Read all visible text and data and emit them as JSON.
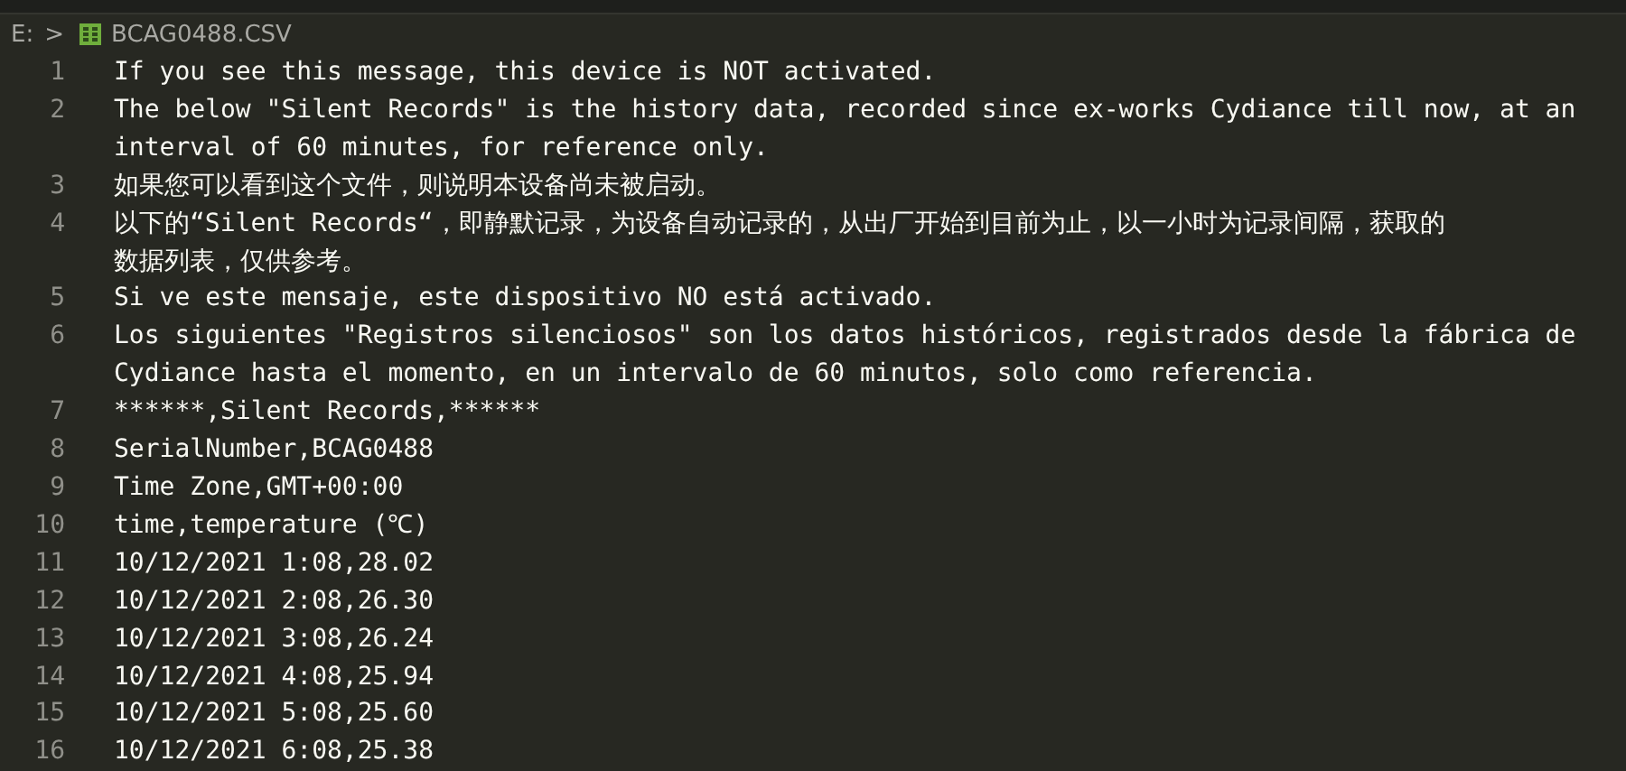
{
  "breadcrumb": {
    "drive": "E:",
    "separator": ">",
    "file": "BCAG0488.CSV"
  },
  "lines": [
    {
      "number": "1",
      "rows": [
        "If you see this message, this device is NOT activated."
      ]
    },
    {
      "number": "2",
      "rows": [
        "The below \"Silent Records\" is the history data, recorded since ex-works Cydiance till now, at an",
        "interval of 60 minutes, for reference only."
      ]
    },
    {
      "number": "3",
      "rows": [
        "如果您可以看到这个文件，则说明本设备尚未被启动。"
      ]
    },
    {
      "number": "4",
      "rows": [
        "以下的“Silent Records“，即静默记录，为设备自动记录的，从出厂开始到目前为止，以一小时为记录间隔，获取的",
        "数据列表，仅供参考。"
      ]
    },
    {
      "number": "5",
      "rows": [
        "Si ve este mensaje, este dispositivo NO está activado."
      ]
    },
    {
      "number": "6",
      "rows": [
        "Los siguientes \"Registros silenciosos\" son los datos históricos, registrados desde la fábrica de",
        "Cydiance hasta el momento, en un intervalo de 60 minutos, solo como referencia."
      ]
    },
    {
      "number": "7",
      "rows": [
        "******,Silent Records,******"
      ]
    },
    {
      "number": "8",
      "rows": [
        "SerialNumber,BCAG0488"
      ]
    },
    {
      "number": "9",
      "rows": [
        "Time Zone,GMT+00:00"
      ]
    },
    {
      "number": "10",
      "rows": [
        "time,temperature (℃)"
      ]
    },
    {
      "number": "11",
      "rows": [
        "10/12/2021 1:08,28.02"
      ]
    },
    {
      "number": "12",
      "rows": [
        "10/12/2021 2:08,26.30"
      ]
    },
    {
      "number": "13",
      "rows": [
        "10/12/2021 3:08,26.24"
      ]
    },
    {
      "number": "14",
      "rows": [
        "10/12/2021 4:08,25.94"
      ]
    },
    {
      "number": "15",
      "rows": [
        "10/12/2021 5:08,25.60"
      ]
    },
    {
      "number": "16",
      "rows": [
        "10/12/2021 6:08,25.38"
      ]
    }
  ]
}
